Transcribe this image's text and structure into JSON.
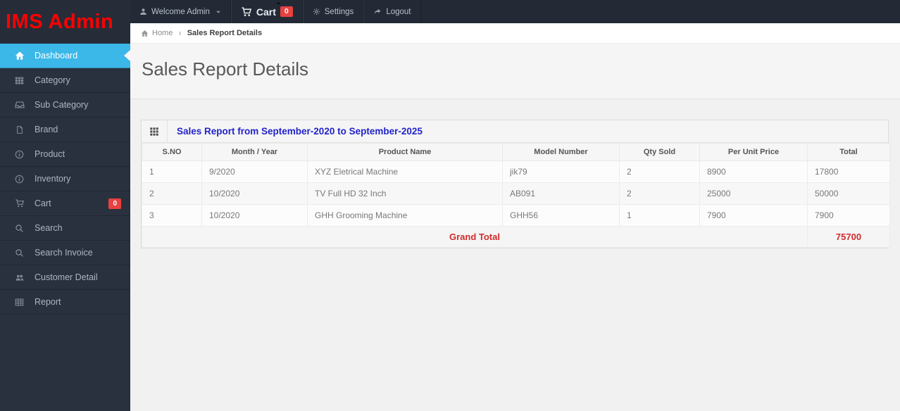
{
  "brand": {
    "logo": "IMS Admin"
  },
  "navbar": {
    "user_menu": {
      "label": "Welcome Admin",
      "icon": "user-icon"
    },
    "cart": {
      "label": "Cart",
      "icon": "cart-icon",
      "badge": "0"
    },
    "settings": {
      "label": "Settings",
      "icon": "gear-icon"
    },
    "logout": {
      "label": "Logout",
      "icon": "logout-icon"
    }
  },
  "breadcrumb": {
    "home": "Home",
    "separator": "›",
    "current": "Sales Report Details"
  },
  "page": {
    "title": "Sales Report Details"
  },
  "sidebar": {
    "items": [
      {
        "label": "Dashboard",
        "icon": "home-icon",
        "active": true
      },
      {
        "label": "Category",
        "icon": "grid-icon"
      },
      {
        "label": "Sub Category",
        "icon": "inbox-icon"
      },
      {
        "label": "Brand",
        "icon": "file-icon"
      },
      {
        "label": "Product",
        "icon": "info-icon"
      },
      {
        "label": "Inventory",
        "icon": "info-icon"
      },
      {
        "label": "Cart",
        "icon": "cart-icon",
        "badge": "0"
      },
      {
        "label": "Search",
        "icon": "search-icon"
      },
      {
        "label": "Search Invoice",
        "icon": "search-icon"
      },
      {
        "label": "Customer Detail",
        "icon": "users-icon"
      },
      {
        "label": "Report",
        "icon": "table-icon"
      }
    ]
  },
  "report": {
    "panel_title": "Sales Report from September-2020 to September-2025",
    "columns": [
      "S.NO",
      "Month / Year",
      "Product Name",
      "Model Number",
      "Qty Sold",
      "Per Unit Price",
      "Total"
    ],
    "rows": [
      [
        "1",
        "9/2020",
        "XYZ Eletrical Machine",
        "jik79",
        "2",
        "8900",
        "17800"
      ],
      [
        "2",
        "10/2020",
        "TV Full HD 32 Inch",
        "AB091",
        "2",
        "25000",
        "50000"
      ],
      [
        "3",
        "10/2020",
        "GHH Grooming Machine",
        "GHH56",
        "1",
        "7900",
        "7900"
      ]
    ],
    "grand_total_label": "Grand Total",
    "grand_total_value": "75700"
  },
  "colors": {
    "sidebar_bg": "#2a313e",
    "navbar_bg": "#232a36",
    "active_item_blue": "#3bb7e8",
    "badge_red": "#e8413f",
    "logo_red": "#ff0000",
    "panel_title_blue": "#2222cc",
    "grand_total_red": "#d22b2b"
  }
}
